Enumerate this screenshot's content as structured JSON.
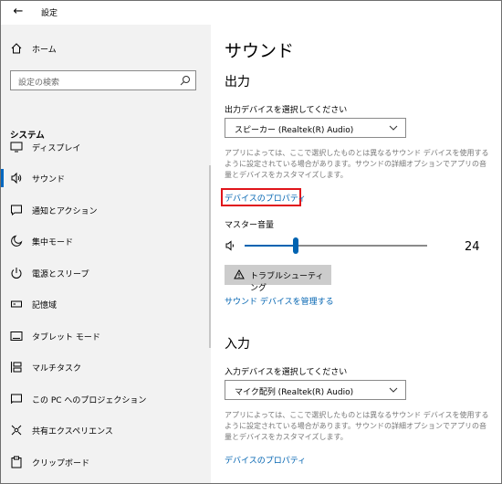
{
  "window": {
    "title": "設定",
    "back_glyph": "←",
    "controls": [
      "minimize-icon",
      "maximize-icon",
      "close-icon"
    ]
  },
  "sidebar": {
    "home": "ホーム",
    "search_placeholder": "設定の検索",
    "section": "システム",
    "items": [
      {
        "label": "ディスプレイ",
        "icon": "display-icon"
      },
      {
        "label": "サウンド",
        "icon": "sound-icon",
        "active": true
      },
      {
        "label": "通知とアクション",
        "icon": "notification-icon"
      },
      {
        "label": "集中モード",
        "icon": "moon-icon"
      },
      {
        "label": "電源とスリープ",
        "icon": "power-icon"
      },
      {
        "label": "記憶域",
        "icon": "storage-icon"
      },
      {
        "label": "タブレット モード",
        "icon": "tablet-icon"
      },
      {
        "label": "マルチタスク",
        "icon": "multitask-icon"
      },
      {
        "label": "この PC へのプロジェクション",
        "icon": "projection-icon"
      },
      {
        "label": "共有エクスペリエンス",
        "icon": "share-icon"
      },
      {
        "label": "クリップボード",
        "icon": "clipboard-icon"
      }
    ]
  },
  "main": {
    "title": "サウンド",
    "output": {
      "heading": "出力",
      "select_label": "出力デバイスを選択してください",
      "selected": "スピーカー (Realtek(R) Audio)",
      "description": "アプリによっては、ここで選択したものとは異なるサウンド デバイスを使用するように設定されている場合があります。サウンドの詳細オプションでアプリの音量とデバイスをカスタマイズします。",
      "properties_link": "デバイスのプロパティ",
      "master_volume_label": "マスター音量",
      "volume_value": "24",
      "volume_fraction": 0.24,
      "troubleshoot_button": "トラブルシューティング",
      "manage_link": "サウンド デバイスを管理する"
    },
    "input": {
      "heading": "入力",
      "select_label": "入力デバイスを選択してください",
      "selected": "マイク配列 (Realtek(R) Audio)",
      "description": "アプリによっては、ここで選択したものとは異なるサウンド デバイスを使用するように設定されている場合があります。サウンドの詳細オプションでアプリの音量とデバイスをカスタマイズします。",
      "properties_link": "デバイスのプロパティ"
    },
    "accent_color": "#0063b1",
    "highlight_color": "#e0141b"
  }
}
